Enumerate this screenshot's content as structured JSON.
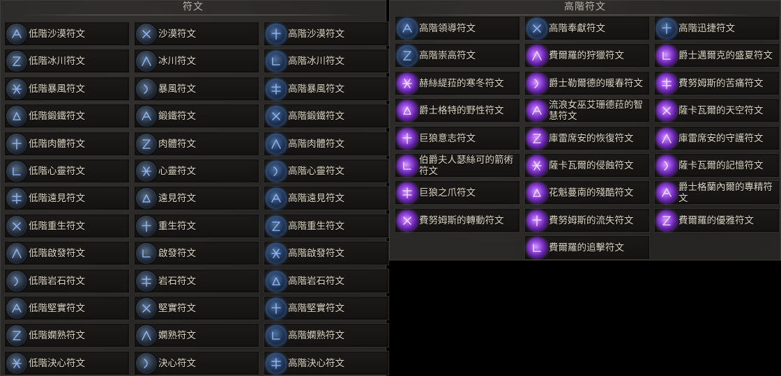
{
  "left_panel": {
    "title": "符文",
    "rows": [
      [
        "低階沙漠符文",
        "沙漠符文",
        "高階沙漠符文"
      ],
      [
        "低階冰川符文",
        "冰川符文",
        "高階冰川符文"
      ],
      [
        "低階暴風符文",
        "暴風符文",
        "高階暴風符文"
      ],
      [
        "低階鍛鐵符文",
        "鍛鐵符文",
        "高階鍛鐵符文"
      ],
      [
        "低階肉體符文",
        "肉體符文",
        "高階肉體符文"
      ],
      [
        "低階心靈符文",
        "心靈符文",
        "高階心靈符文"
      ],
      [
        "低階遠見符文",
        "遠見符文",
        "高階遠見符文"
      ],
      [
        "低階重生符文",
        "重生符文",
        "高階重生符文"
      ],
      [
        "低階啟發符文",
        "啟發符文",
        "高階啟發符文"
      ],
      [
        "低階岩石符文",
        "岩石符文",
        "高階岩石符文"
      ],
      [
        "低階堅實符文",
        "堅實符文",
        "高階堅實符文"
      ],
      [
        "低階嫻熟符文",
        "嫻熟符文",
        "高階嫻熟符文"
      ],
      [
        "低階決心符文",
        "決心符文",
        "高階決心符文"
      ]
    ]
  },
  "right_panel": {
    "title": "高階符文",
    "rows": [
      [
        "高階領導符文",
        "高階奉獻符文",
        "高階迅捷符文"
      ],
      [
        "高階崇高符文",
        "費爾羅的狩獵符文",
        "爵士邁爾克的盛夏符文"
      ],
      [
        "赫絲緹菈的寒冬符文",
        "爵士勒爾德的暖春符文",
        "費努姆斯的苦痛符文"
      ],
      [
        "爵士格特的野性符文",
        "流浪女巫艾珊德菈的智慧符文",
        "薩卡瓦爾的天空符文"
      ],
      [
        "巨狼意志符文",
        "庫雷席安的恢復符文",
        "庫雷席安的守護符文"
      ],
      [
        "伯爵夫人瑟絲可的箭術符文",
        "薩卡瓦爾的侵蝕符文",
        "薩卡瓦爾的記憶符文"
      ],
      [
        "巨狼之爪符文",
        "花魁蔓南的殘酷符文",
        "爵士格蘭內爾的專精符文"
      ],
      [
        "費努姆斯的轉動符文",
        "費努姆斯的流失符文",
        "費爾羅的優雅符文"
      ],
      [
        null,
        "費爾羅的追擊符文",
        null
      ]
    ]
  },
  "rune_colors": {
    "blue_glyph": "#8fb8ff",
    "purple_glyph": "#f2dcff"
  }
}
